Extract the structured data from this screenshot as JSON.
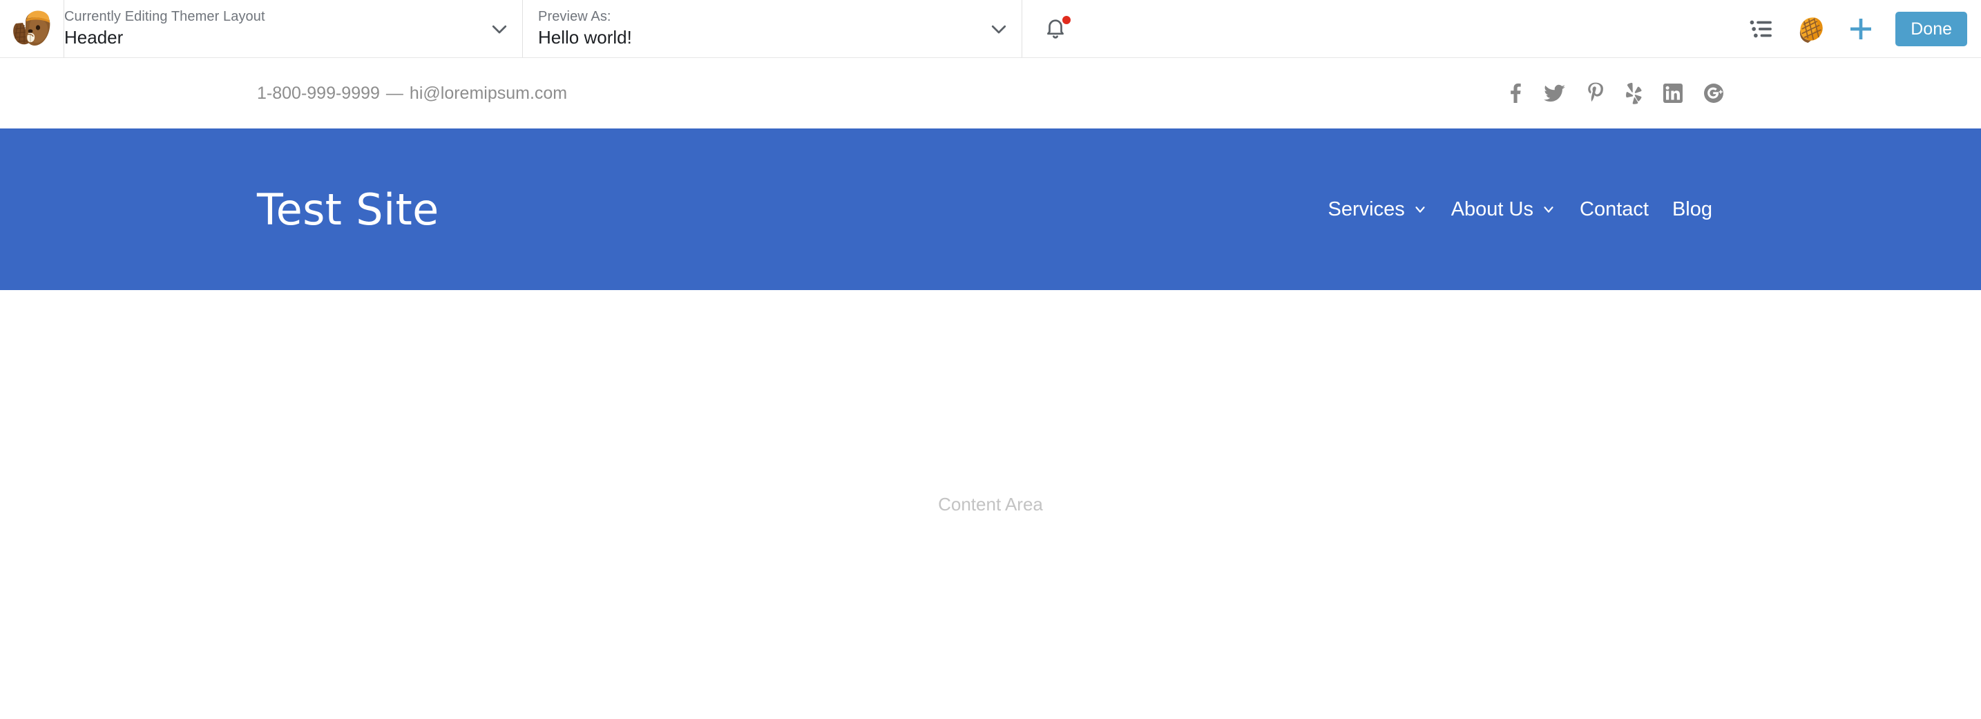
{
  "admin_bar": {
    "logo_icon": "beaver-builder-logo",
    "editing": {
      "label": "Currently Editing Themer Layout",
      "value": "Header",
      "caret_icon": "chevron-down-icon"
    },
    "preview": {
      "label": "Preview As:",
      "value": "Hello world!",
      "caret_icon": "chevron-down-icon"
    },
    "notifications": {
      "icon": "bell-icon",
      "has_unread": true,
      "badge_color": "#e02b1d"
    },
    "tools": [
      {
        "icon": "outline-list-icon",
        "name": "tools-outline-button"
      },
      {
        "icon": "beaver-tail-icon",
        "name": "tools-templates-button"
      },
      {
        "icon": "plus-icon",
        "name": "add-content-button"
      }
    ],
    "done_label": "Done",
    "done_color": "#4d9fcc",
    "accent_color": "#4d9fcc"
  },
  "contact_bar": {
    "phone": "1-800-999-9999",
    "separator": "—",
    "email": "hi@loremipsum.com",
    "social": [
      {
        "name": "facebook-icon",
        "label": "Facebook"
      },
      {
        "name": "twitter-icon",
        "label": "Twitter"
      },
      {
        "name": "pinterest-icon",
        "label": "Pinterest"
      },
      {
        "name": "yelp-icon",
        "label": "Yelp"
      },
      {
        "name": "linkedin-icon",
        "label": "LinkedIn"
      },
      {
        "name": "google-plus-icon",
        "label": "Google Plus"
      }
    ],
    "icon_color": "#878787"
  },
  "site_header": {
    "title": "Test Site",
    "background_color": "#3a68c4",
    "nav": [
      {
        "label": "Services",
        "has_dropdown": true
      },
      {
        "label": "About Us",
        "has_dropdown": true
      },
      {
        "label": "Contact",
        "has_dropdown": false
      },
      {
        "label": "Blog",
        "has_dropdown": false
      }
    ]
  },
  "content": {
    "placeholder": "Content Area"
  }
}
